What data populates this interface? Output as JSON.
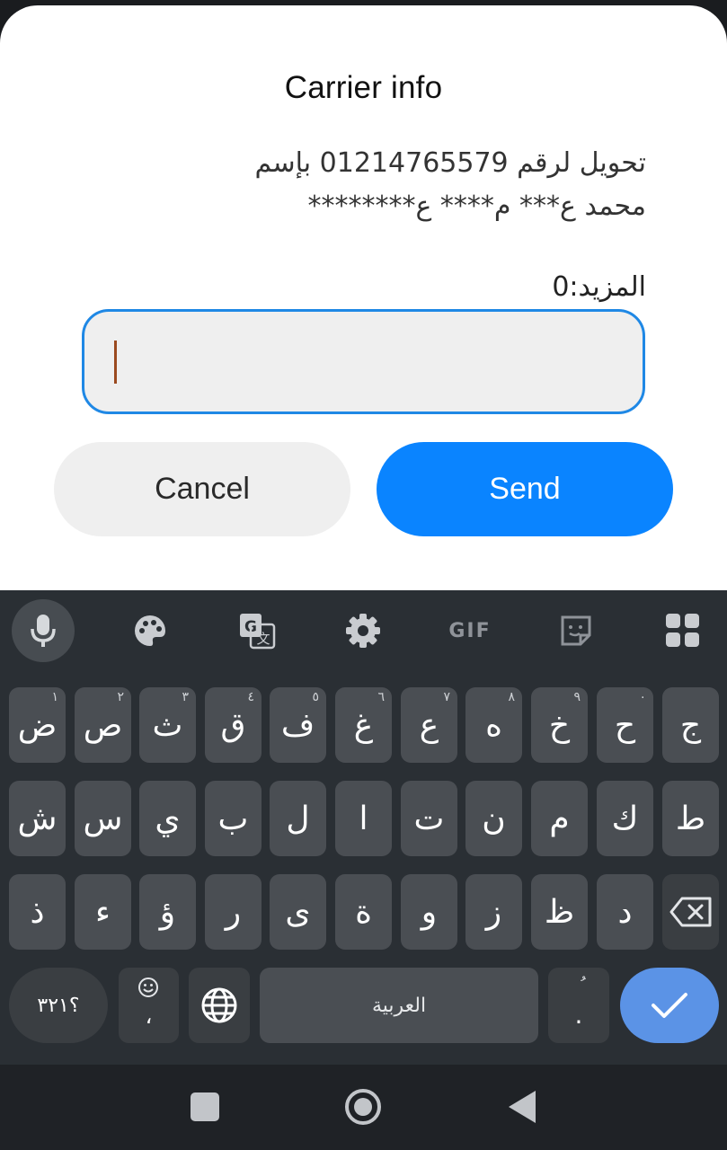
{
  "dialog": {
    "title": "Carrier info",
    "message_line1": "تحويل لرقم 01214765579 بإسم",
    "message_line2": "محمد ع*** م**** ع********",
    "prompt": "المزيد:0",
    "input_value": "",
    "cancel_label": "Cancel",
    "send_label": "Send"
  },
  "keyboard": {
    "row1": [
      {
        "char": "ض",
        "hint": "١"
      },
      {
        "char": "ص",
        "hint": "٢"
      },
      {
        "char": "ث",
        "hint": "٣"
      },
      {
        "char": "ق",
        "hint": "٤"
      },
      {
        "char": "ف",
        "hint": "٥"
      },
      {
        "char": "غ",
        "hint": "٦"
      },
      {
        "char": "ع",
        "hint": "٧"
      },
      {
        "char": "ه",
        "hint": "٨"
      },
      {
        "char": "خ",
        "hint": "٩"
      },
      {
        "char": "ح",
        "hint": "٠"
      },
      {
        "char": "ج",
        "hint": ""
      }
    ],
    "row2": [
      "ش",
      "س",
      "ي",
      "ب",
      "ل",
      "ا",
      "ت",
      "ن",
      "م",
      "ك",
      "ط"
    ],
    "row3": [
      "ذ",
      "ء",
      "ؤ",
      "ر",
      "ى",
      "ة",
      "و",
      "ز",
      "ظ",
      "د"
    ],
    "symbols_label": "؟٣٢١",
    "comma_label": "،",
    "space_label": "العربية",
    "period_label": ".",
    "period_hint": "ُ",
    "toolbar": {
      "gif_label": "GIF"
    }
  },
  "colors": {
    "accent": "#0a84ff",
    "input_border": "#1f88e5",
    "keyboard_bg": "#2a2f34",
    "key_bg": "#4a4e53",
    "enter_key": "#5b93e6"
  },
  "icons": {
    "toolbar": [
      "microphone-icon",
      "palette-icon",
      "translate-icon",
      "settings-icon",
      "gif-icon",
      "sticker-icon",
      "apps-grid-icon"
    ],
    "keys": [
      "backspace-icon",
      "emoji-icon",
      "globe-icon",
      "check-icon"
    ],
    "nav": [
      "recents-square-icon",
      "home-circle-icon",
      "back-triangle-icon"
    ]
  }
}
